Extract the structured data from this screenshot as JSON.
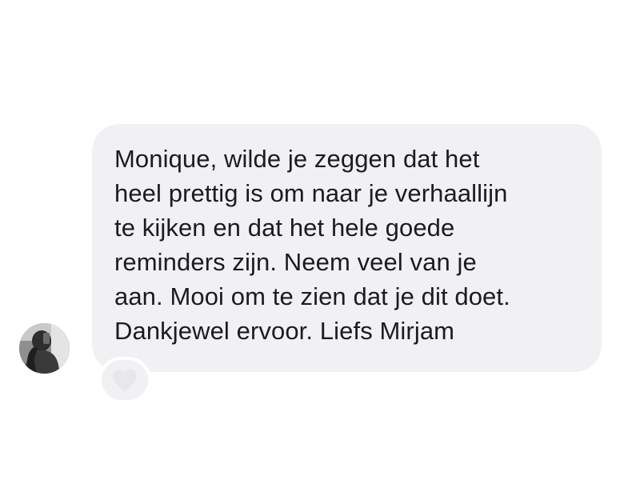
{
  "message": {
    "lines": [
      "Monique, wilde je zeggen dat het",
      "heel prettig is om naar je verhaallijn",
      "te kijken en dat het hele goede",
      "reminders zijn. Neem veel van je",
      "aan. Mooi om te zien dat je dit doet.",
      "Dankjewel ervoor. Liefs Mirjam"
    ],
    "bubble_color": "#f1f1f3",
    "text_color": "#1c1c1e"
  },
  "sender": {
    "avatar_icon": "user-avatar-photo"
  },
  "reaction": {
    "icon": "heart-icon",
    "color": "#e8e8ea"
  }
}
